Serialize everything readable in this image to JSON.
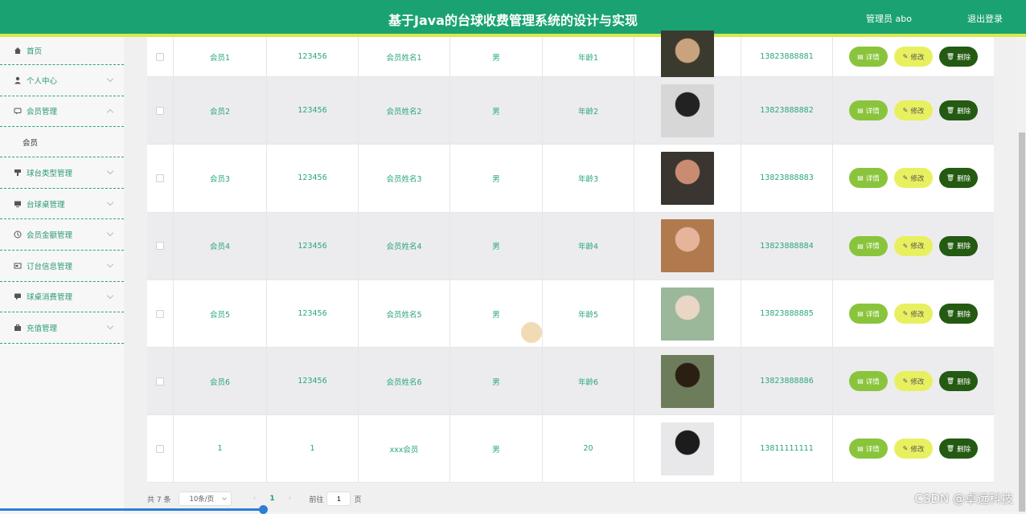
{
  "header": {
    "title": "基于Java的台球收费管理系统的设计与实现",
    "user": "管理员 abo",
    "logout": "退出登录"
  },
  "sidebar": {
    "items": [
      {
        "label": "首页"
      },
      {
        "label": "个人中心"
      },
      {
        "label": "会员管理"
      },
      {
        "label": "会员"
      },
      {
        "label": "球台类型管理"
      },
      {
        "label": "台球桌管理"
      },
      {
        "label": "会员金额管理"
      },
      {
        "label": "订台信息管理"
      },
      {
        "label": "球桌消费管理"
      },
      {
        "label": "充值管理"
      }
    ]
  },
  "table": {
    "rows": [
      {
        "account": "会员1",
        "password": "123456",
        "name": "会员姓名1",
        "gender": "男",
        "age": "年龄1",
        "phone": "13823888881"
      },
      {
        "account": "会员2",
        "password": "123456",
        "name": "会员姓名2",
        "gender": "男",
        "age": "年龄2",
        "phone": "13823888882"
      },
      {
        "account": "会员3",
        "password": "123456",
        "name": "会员姓名3",
        "gender": "男",
        "age": "年龄3",
        "phone": "13823888883"
      },
      {
        "account": "会员4",
        "password": "123456",
        "name": "会员姓名4",
        "gender": "男",
        "age": "年龄4",
        "phone": "13823888884"
      },
      {
        "account": "会员5",
        "password": "123456",
        "name": "会员姓名5",
        "gender": "男",
        "age": "年龄5",
        "phone": "13823888885"
      },
      {
        "account": "会员6",
        "password": "123456",
        "name": "会员姓名6",
        "gender": "男",
        "age": "年龄6",
        "phone": "13823888886"
      },
      {
        "account": "1",
        "password": "1",
        "name": "xxx会员",
        "gender": "男",
        "age": "20",
        "phone": "13811111111"
      }
    ],
    "actions": {
      "detail": "详情",
      "edit": "修改",
      "delete": "删除"
    }
  },
  "pager": {
    "total": "共 7 条",
    "page_size": "10条/页",
    "current": "1",
    "goto_label": "前往",
    "goto_value": "1",
    "page_unit": "页"
  },
  "watermark": "CSDN @卓远科技",
  "colors": {
    "primary": "#1aa272",
    "accent": "#d8e84c",
    "detail": "#8ac43c",
    "edit": "#e8f060",
    "delete": "#245a12"
  }
}
